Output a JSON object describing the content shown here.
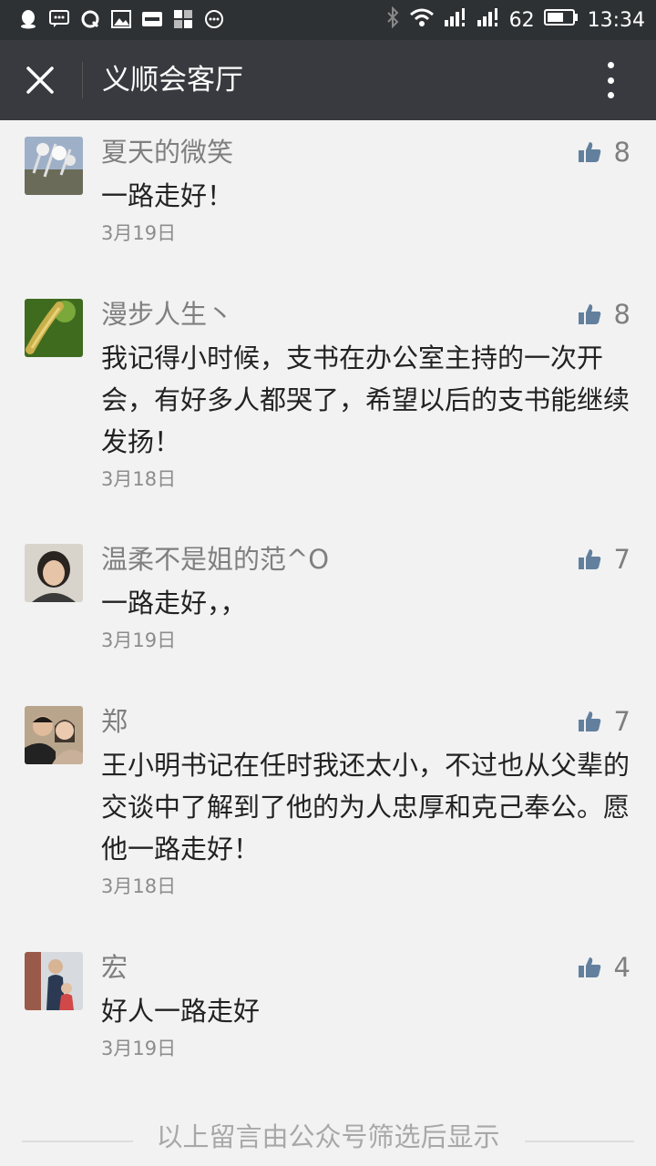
{
  "status_bar": {
    "battery": "62",
    "time": "13:34"
  },
  "header": {
    "title": "义顺会客厅"
  },
  "comments": [
    {
      "nickname": "夏天的微笑",
      "text": "一路走好！",
      "date": "3月19日",
      "likes": "8"
    },
    {
      "nickname": "漫步人生丶",
      "text": "我记得小时候，支书在办公室主持的一次开会，有好多人都哭了，希望以后的支书能继续发扬！",
      "date": "3月18日",
      "likes": "8"
    },
    {
      "nickname": "温柔不是姐的范^O",
      "text": "一路走好，，",
      "date": "3月19日",
      "likes": "7"
    },
    {
      "nickname": "郑",
      "text": "王小明书记在任时我还太小，不过也从父辈的交谈中了解到了他的为人忠厚和克己奉公。愿他一路走好！",
      "date": "3月18日",
      "likes": "7"
    },
    {
      "nickname": "宏",
      "text": "好人一路走好",
      "date": "3月19日",
      "likes": "4"
    }
  ],
  "footer": {
    "note": "以上留言由公众号筛选后显示"
  }
}
